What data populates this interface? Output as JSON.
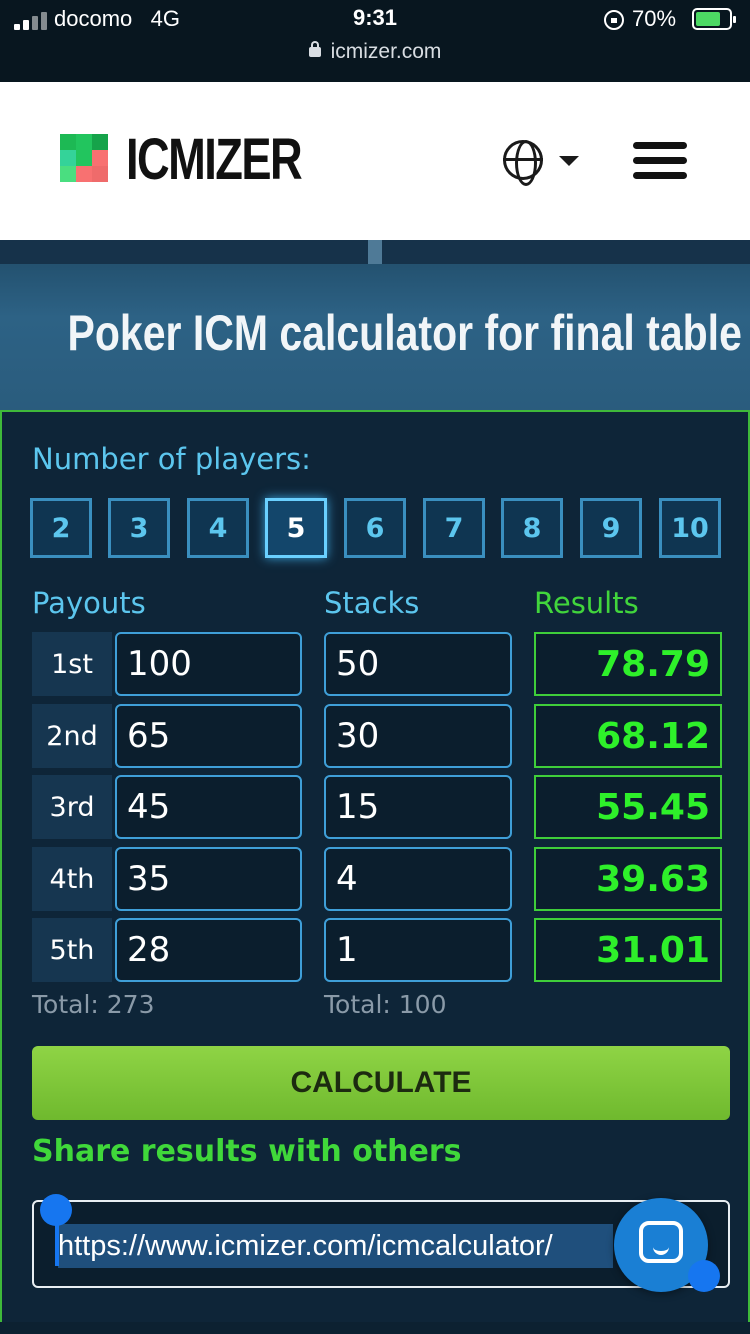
{
  "status_bar": {
    "carrier": "docomo",
    "network": "4G",
    "time": "9:31",
    "battery_percent": "70%",
    "url": "icmizer.com"
  },
  "header": {
    "logo_text": "ICMIZER",
    "language_icon": "globe-icon",
    "menu_icon": "hamburger-icon"
  },
  "hero": {
    "title": "Poker ICM calculator for final table deals"
  },
  "calculator": {
    "players_label": "Number of players:",
    "player_options": [
      "2",
      "3",
      "4",
      "5",
      "6",
      "7",
      "8",
      "9",
      "10"
    ],
    "selected_players": "5",
    "payouts_label": "Payouts",
    "stacks_label": "Stacks",
    "results_label": "Results",
    "rows": [
      {
        "place": "1st",
        "payout": "100",
        "stack": "50",
        "result": "78.79"
      },
      {
        "place": "2nd",
        "payout": "65",
        "stack": "30",
        "result": "68.12"
      },
      {
        "place": "3rd",
        "payout": "45",
        "stack": "15",
        "result": "55.45"
      },
      {
        "place": "4th",
        "payout": "35",
        "stack": "4",
        "result": "39.63"
      },
      {
        "place": "5th",
        "payout": "28",
        "stack": "1",
        "result": "31.01"
      }
    ],
    "payouts_total": "Total: 273",
    "stacks_total": "Total: 100",
    "calculate_label": "CALCULATE"
  },
  "share": {
    "title": "Share results with others",
    "url": "https://www.icmizer.com/icmcalculator/"
  },
  "colors": {
    "accent_blue": "#5cc6ee",
    "result_green": "#2ef02a",
    "button_green": "#7ec43a",
    "panel_bg": "#0e2538"
  }
}
